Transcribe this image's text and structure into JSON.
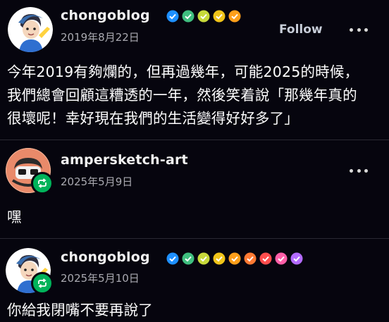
{
  "posts": [
    {
      "username": "chongoblog",
      "date": "2019年8月22日",
      "follow_label": "Follow",
      "badges": [
        "#1e90ff",
        "#3fbf7f",
        "#c7d93a",
        "#f0c419",
        "#ff9f1a"
      ],
      "lines": [
        "今年2019有夠爛的，但再過幾年，可能2025的時候，",
        "我們總會回顧這糟透的一年，然後笑着說「那幾年真的",
        "很壞呢！幸好現在我們的生活變得好好多了」"
      ]
    },
    {
      "username": "ampersketch-art",
      "date": "2025年5月9日",
      "lines": [
        "嘿"
      ]
    },
    {
      "username": "chongoblog",
      "date": "2025年5月10日",
      "badges": [
        "#1e90ff",
        "#3fbf7f",
        "#c7d93a",
        "#f0c419",
        "#ff9f1a",
        "#ff7a33",
        "#ff4d4d",
        "#ff5fa8",
        "#b36bff"
      ],
      "lines": [
        "你給我閉嘴不要再說了"
      ]
    }
  ],
  "icons": {
    "more": "more-options-icon",
    "reblog": "reblog-icon",
    "badge": "verified-badge-icon"
  }
}
